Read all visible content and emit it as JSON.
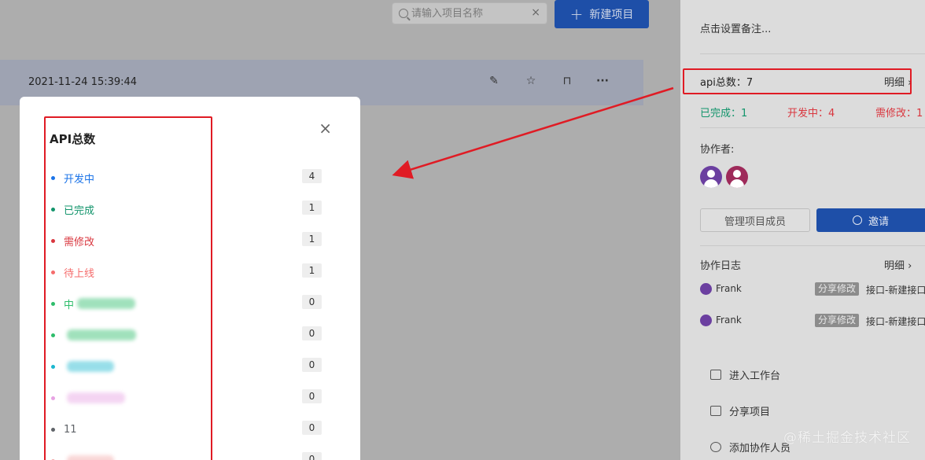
{
  "main": {
    "search": {
      "placeholder": "请输入项目名称",
      "clear_glyph": "×"
    },
    "new_project_label": "新建项目",
    "new_project_glyph": "+",
    "row": {
      "timestamp": "2021-11-24 15:39:44",
      "actions": [
        {
          "icon": "edit-icon",
          "glyph": "✎"
        },
        {
          "icon": "star-icon",
          "glyph": "☆"
        },
        {
          "icon": "lock-icon",
          "glyph": "⊓"
        },
        {
          "icon": "more-icon",
          "glyph": "···"
        }
      ]
    }
  },
  "modal": {
    "title": "API总数",
    "close_glyph": "×",
    "items": [
      {
        "label": "开发中",
        "count": "4",
        "color": "#1a73e8"
      },
      {
        "label": "已完成",
        "count": "1",
        "color": "#12946b"
      },
      {
        "label": "需修改",
        "count": "1",
        "color": "#d9363e"
      },
      {
        "label": "待上线",
        "count": "1",
        "color": "#f56c6c"
      },
      {
        "label": "中",
        "count": "0",
        "color": "#2ebd6b",
        "blurred": true
      },
      {
        "label": "",
        "count": "0",
        "color": "#2ebd6b",
        "blurred": true
      },
      {
        "label": "",
        "count": "0",
        "color": "#1bb7cf",
        "blurred": true
      },
      {
        "label": "",
        "count": "0",
        "color": "#e7a2e3",
        "blurred": true
      },
      {
        "label": "11",
        "count": "0",
        "color": "#5f6368"
      },
      {
        "label": "",
        "count": "0",
        "color": "#f2a6a6",
        "blurred": true
      }
    ]
  },
  "panel": {
    "note": "点击设置备注...",
    "api_total": "api总数：7",
    "detail_label": "明细",
    "status": [
      {
        "text": "已完成：1",
        "color": "#12946b"
      },
      {
        "text": "开发中：4",
        "color": "#d9363e"
      },
      {
        "text": "需修改：1",
        "color": "#d9363e"
      }
    ],
    "collaborators_title": "协作者:",
    "avatar_colors": [
      "#6b3fa0",
      "#9e2a5a"
    ],
    "manage_label": "管理项目成员",
    "invite_label": "邀请",
    "log_title": "协作日志",
    "log_detail_label": "明细",
    "logs": [
      {
        "user": "Frank",
        "tag": "分享修改",
        "target": "接口-新建接口"
      },
      {
        "user": "Frank",
        "tag": "分享修改",
        "target": "接口-新建接口"
      }
    ],
    "actions": [
      {
        "label": "进入工作台",
        "icon": "terminal-icon"
      },
      {
        "label": "分享项目",
        "icon": "share-icon"
      },
      {
        "label": "添加协作人员",
        "icon": "add-user-icon"
      }
    ]
  },
  "watermark": "@稀土掘金技术社区",
  "annotation_color": "#e01b24"
}
